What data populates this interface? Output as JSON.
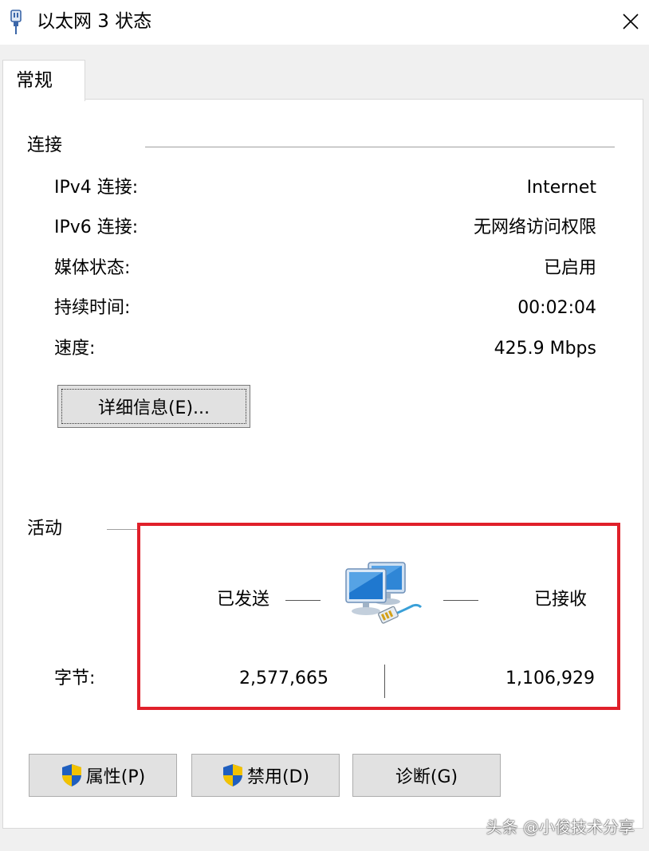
{
  "window": {
    "title": "以太网 3 状态",
    "icons": {
      "app": "ethernet-plug-icon",
      "close": "close-icon"
    }
  },
  "tabs": [
    {
      "label": "常规",
      "selected": true
    }
  ],
  "connection": {
    "title": "连接",
    "rows": [
      {
        "label": "IPv4 连接:",
        "value": "Internet"
      },
      {
        "label": "IPv6 连接:",
        "value": "无网络访问权限"
      },
      {
        "label": "媒体状态:",
        "value": "已启用"
      },
      {
        "label": "持续时间:",
        "value": "00:02:04"
      },
      {
        "label": "速度:",
        "value": "425.9 Mbps"
      }
    ],
    "details_button": "详细信息(E)..."
  },
  "activity": {
    "title": "活动",
    "sent_label": "已发送",
    "received_label": "已接收",
    "bytes_label": "字节:",
    "bytes_sent": "2,577,665",
    "bytes_received": "1,106,929",
    "icon": "network-computers-icon"
  },
  "buttons": {
    "properties": "属性(P)",
    "disable": "禁用(D)",
    "diagnose": "诊断(G)",
    "shield_icon": "uac-shield-icon"
  },
  "watermark": "头条 @小俊技术分享",
  "colors": {
    "highlight": "#e0202a",
    "button_face": "#e1e1e1",
    "window_bg": "#f0f0f0"
  }
}
